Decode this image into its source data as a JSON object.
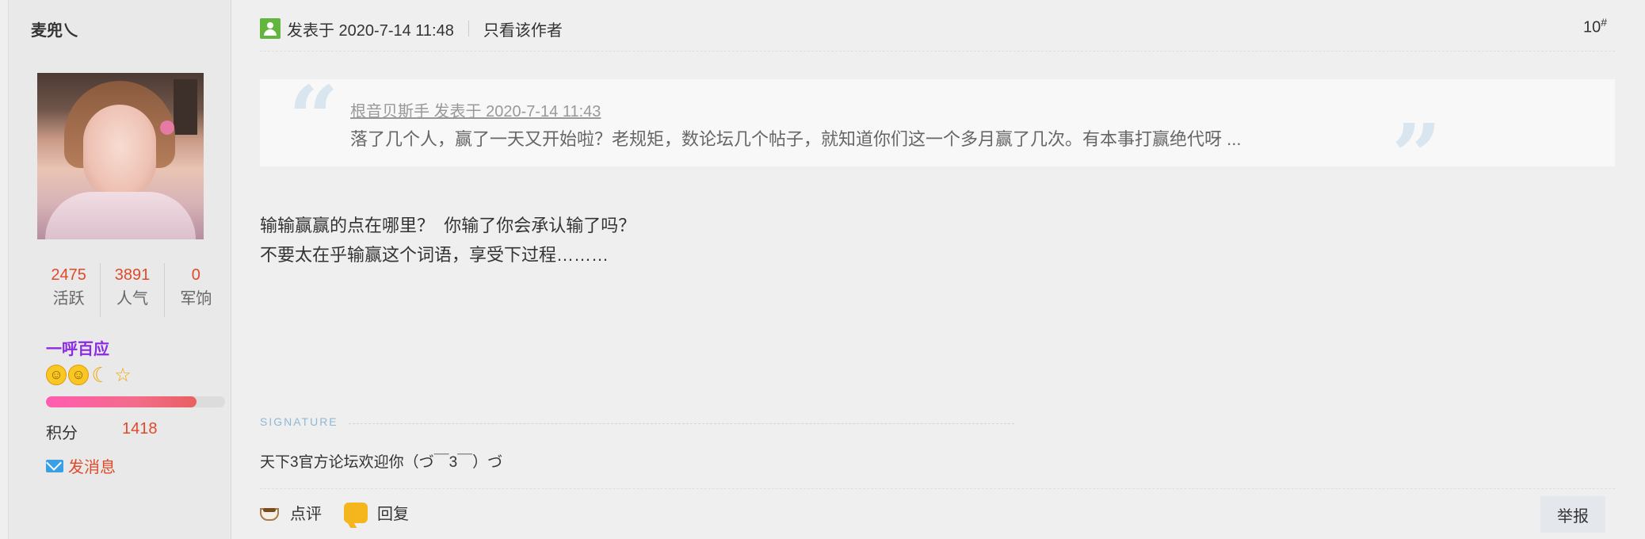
{
  "user": {
    "name": "麦兜乀",
    "stats": [
      {
        "value": "2475",
        "label": "活跃"
      },
      {
        "value": "3891",
        "label": "人气"
      },
      {
        "value": "0",
        "label": "军饷"
      }
    ],
    "rank": "一呼百应",
    "medals": [
      "sun-icon",
      "sun-icon",
      "moon-icon",
      "star-icon"
    ],
    "level_progress": 0.84,
    "points_label": "积分",
    "points_value": "1418",
    "message_label": "发消息"
  },
  "post": {
    "posted_label": "发表于 2020-7-14 11:48",
    "author_only": "只看该作者",
    "floor_number": "10",
    "floor_symbol": "#",
    "quote": {
      "author": "根音贝斯手 发表于 2020-7-14 11:43",
      "text": "落了几个人，赢了一天又开始啦？老规矩，数论坛几个帖子，就知道你们这一个多月赢了几次。有本事打赢绝代呀 ..."
    },
    "content_lines": [
      "输输赢赢的点在哪里？  你输了你会承认输了吗？",
      "不要太在乎输赢这个词语，享受下过程………"
    ],
    "signature_label": "SIGNATURE",
    "signature": "天下3官方论坛欢迎你（づ￣3￣）づ",
    "actions": {
      "comment": "点评",
      "reply": "回复",
      "report": "举报"
    }
  },
  "colors": {
    "accent_red": "#e04a2a",
    "rank_purple": "#8a2be2",
    "author_green": "#62b53d"
  }
}
